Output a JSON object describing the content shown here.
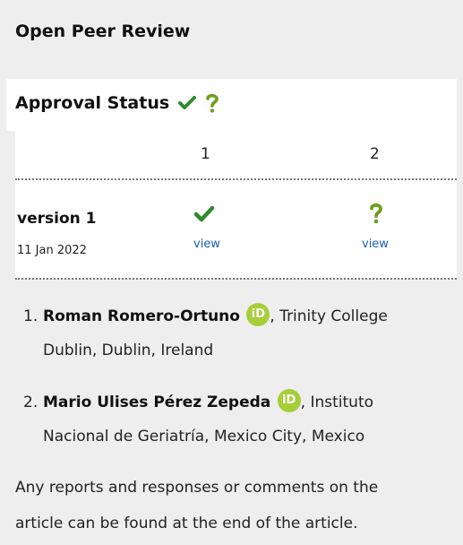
{
  "header": {
    "title": "Open Peer Review"
  },
  "approval": {
    "title": "Approval Status"
  },
  "table": {
    "columns": [
      "1",
      "2"
    ],
    "version_label": "version 1",
    "version_date": "11 Jan 2022",
    "view_labels": [
      "view",
      "view"
    ]
  },
  "reviewers": [
    {
      "number": "1.",
      "name": "Roman Romero-Ortuno",
      "affil_part1": ", Trinity College",
      "affil_part2": "Dublin, Dublin, Ireland"
    },
    {
      "number": "2.",
      "name": "Mario Ulises Pérez Zepeda",
      "affil_part1": ", Instituto",
      "affil_part2": "Nacional de Geriatría, Mexico City, Mexico"
    }
  ],
  "orcid_glyph": "iD",
  "footer": {
    "line1": "Any reports and responses or comments on the",
    "line2": "article can be found at the end of the article."
  },
  "colors": {
    "approved": "#2e8b2e",
    "questioned": "#6b9f1a",
    "link": "#1a5fb4",
    "orcid": "#a6ce39"
  }
}
